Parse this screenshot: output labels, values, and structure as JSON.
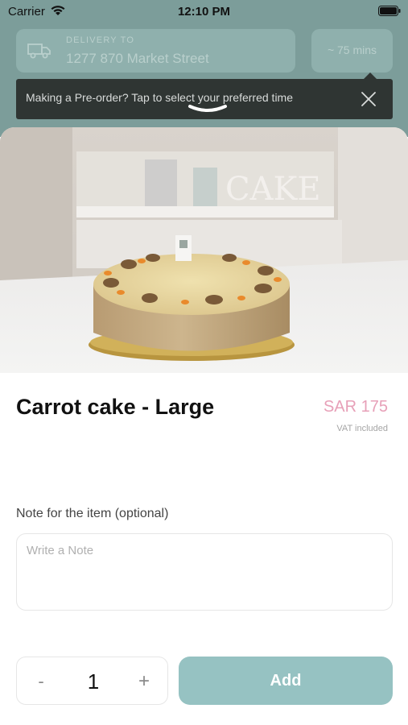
{
  "status_bar": {
    "carrier": "Carrier",
    "time": "12:10 PM",
    "icons": [
      "wifi-icon",
      "battery-icon"
    ]
  },
  "header": {
    "delivery_label": "DELIVERY TO",
    "delivery_address": "1277 870 Market Street",
    "eta": "~ 75 mins",
    "delivery_icon": "truck-icon"
  },
  "preorder_banner": {
    "text": "Making a Pre-order? Tap to select your preferred time",
    "close_icon": "close-icon"
  },
  "product": {
    "title": "Carrot cake - Large",
    "price": "SAR 175",
    "vat_note": "VAT included",
    "image": "carrot-cake-photo"
  },
  "note": {
    "label": "Note for the item (optional)",
    "placeholder": "Write a Note",
    "value": ""
  },
  "quantity": {
    "minus_label": "-",
    "value": "1",
    "plus_label": "+"
  },
  "actions": {
    "add_label": "Add"
  },
  "colors": {
    "accent": "#96c2c2",
    "price": "#e7a0b8",
    "background_header": "#7c9d9a",
    "banner": "#2f3533"
  }
}
